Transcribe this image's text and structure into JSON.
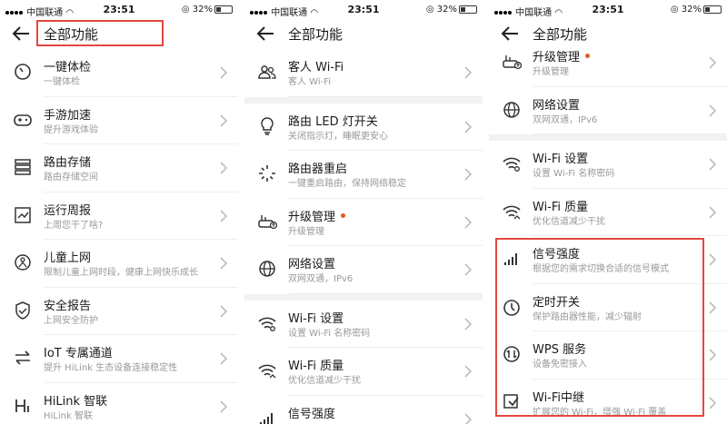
{
  "status": {
    "carrier": "中国联通",
    "time": "23:51",
    "battery": "32%",
    "battery_level": 0.32
  },
  "header": {
    "title": "全部功能"
  },
  "panel1": {
    "items": [
      {
        "icon": "gauge-icon",
        "name": "一键体检",
        "sub": "一键体检"
      },
      {
        "icon": "gamepad-icon",
        "name": "手游加速",
        "sub": "提升游戏体验"
      },
      {
        "icon": "storage-icon",
        "name": "路由存储",
        "sub": "路由存储空间"
      },
      {
        "icon": "report-icon",
        "name": "运行周报",
        "sub": "上周您干了啥?"
      },
      {
        "icon": "child-icon",
        "name": "儿童上网",
        "sub": "限制儿童上网时段，健康上网快乐成长"
      },
      {
        "icon": "shield-icon",
        "name": "安全报告",
        "sub": "上网安全防护"
      },
      {
        "icon": "swap-arrows-icon",
        "name": "IoT 专属通道",
        "sub": "提升 HiLink 生态设备连接稳定性"
      },
      {
        "icon": "hilink-icon",
        "name": "HiLink 智联",
        "sub": "HiLink 智联"
      }
    ]
  },
  "panel2": {
    "items": [
      {
        "icon": "guest-icon",
        "name": "客人 Wi-Fi",
        "sub": "客人 Wi-Fi"
      },
      {
        "icon": "bulb-icon",
        "name": "路由 LED 灯开关",
        "sub": "关闭指示灯，睡眠更安心"
      },
      {
        "icon": "restart-icon",
        "name": "路由器重启",
        "sub": "一键重启路由，保持网络稳定"
      },
      {
        "icon": "upgrade-icon",
        "name": "升级管理",
        "sub": "升级管理",
        "dot": true
      },
      {
        "icon": "globe-icon",
        "name": "网络设置",
        "sub": "双网双通，IPv6"
      },
      {
        "icon": "wifi-settings-icon",
        "name": "Wi-Fi 设置",
        "sub": "设置 Wi-Fi 名称密码"
      },
      {
        "icon": "wifi-quality-icon",
        "name": "Wi-Fi 质量",
        "sub": "优化信道减少干扰"
      },
      {
        "icon": "signal-icon",
        "name": "信号强度",
        "sub": ""
      }
    ]
  },
  "panel3": {
    "items": [
      {
        "icon": "upgrade-icon",
        "name": "升级管理",
        "sub": "升级管理",
        "dot": true
      },
      {
        "icon": "globe-icon",
        "name": "网络设置",
        "sub": "双网双通，IPv6"
      },
      {
        "icon": "wifi-settings-icon",
        "name": "Wi-Fi 设置",
        "sub": "设置 Wi-Fi 名称密码"
      },
      {
        "icon": "wifi-quality-icon",
        "name": "Wi-Fi 质量",
        "sub": "优化信道减少干扰"
      },
      {
        "icon": "signal-icon",
        "name": "信号强度",
        "sub": "根据您的需求切换合适的信号模式"
      },
      {
        "icon": "timer-icon",
        "name": "定时开关",
        "sub": "保护路由器性能，减少辐射"
      },
      {
        "icon": "wps-icon",
        "name": "WPS 服务",
        "sub": "设备免密接入"
      },
      {
        "icon": "repeater-icon",
        "name": "Wi-Fi中继",
        "sub": "扩展您的 Wi-Fi，增强 Wi-Fi 覆盖"
      }
    ]
  },
  "colors": {
    "highlight": "#e4473f",
    "dot": "#e05a1f"
  }
}
